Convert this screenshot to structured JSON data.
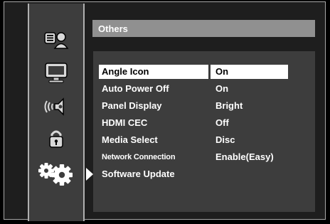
{
  "menu": {
    "title": "Others",
    "items": [
      {
        "label": "Angle Icon",
        "value": "On",
        "selected": true
      },
      {
        "label": "Auto Power Off",
        "value": "On",
        "selected": false
      },
      {
        "label": "Panel Display",
        "value": "Bright",
        "selected": false
      },
      {
        "label": "HDMI CEC",
        "value": "Off",
        "selected": false
      },
      {
        "label": "Media Select",
        "value": "Disc",
        "selected": false
      },
      {
        "label": "Network Connection",
        "value": "Enable(Easy)",
        "selected": false
      },
      {
        "label": "Software Update",
        "value": "",
        "selected": false
      }
    ]
  },
  "sidebar": {
    "icons": [
      "language-icon",
      "display-icon",
      "audio-icon",
      "lock-icon",
      "others-gear-icon"
    ],
    "active_index": 4
  },
  "colors": {
    "panel": "#3d3d3d",
    "title_bar": "#909090",
    "highlight": "#ffffff"
  }
}
